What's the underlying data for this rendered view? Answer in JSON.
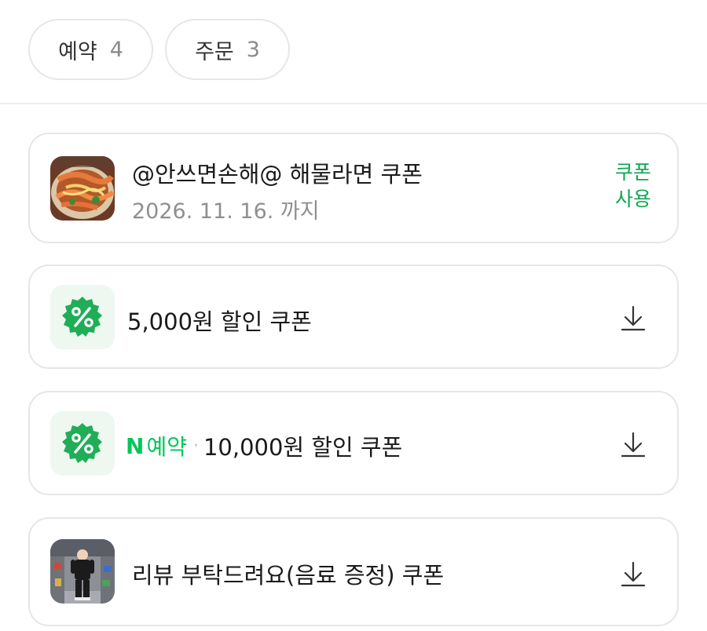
{
  "tabs": [
    {
      "label": "예약",
      "count": "4"
    },
    {
      "label": "주문",
      "count": "3"
    }
  ],
  "coupons": [
    {
      "title": "@안쓰면손해@ 해물라면 쿠폰",
      "expiry": "2026. 11. 16. 까지",
      "action_label": "쿠폰 사용",
      "icon": "food-photo"
    },
    {
      "title": "5,000원 할인 쿠폰",
      "icon": "percent-badge-icon",
      "action_icon": "download-icon"
    },
    {
      "brand_logo": "N",
      "brand_label": "예약",
      "separator": "·",
      "title": "10,000원 할인 쿠폰",
      "icon": "percent-badge-icon",
      "action_icon": "download-icon"
    },
    {
      "title": "리뷰 부탁드려요(음료 증정) 쿠폰",
      "icon": "store-photo",
      "action_icon": "download-icon"
    }
  ],
  "colors": {
    "accent_green": "#03c75a",
    "action_green": "#0fa653",
    "badge_green": "#1fae57",
    "border": "#e6e6e6",
    "muted_text": "#8f8f8f"
  }
}
